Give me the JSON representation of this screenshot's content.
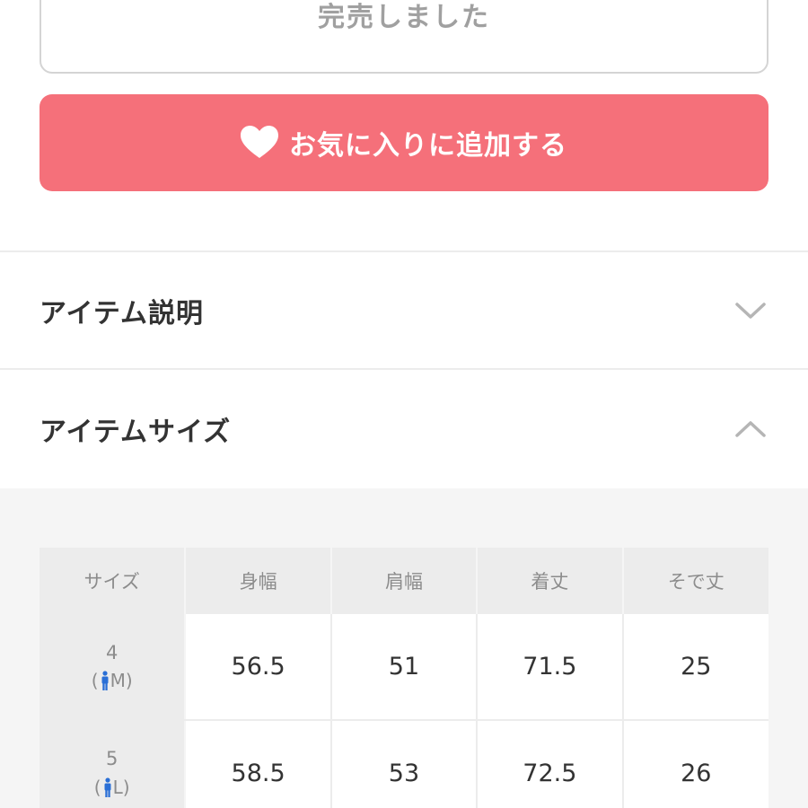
{
  "soldout": {
    "label": "完売しました"
  },
  "favorite": {
    "label": "お気に入りに追加する",
    "color": "#f5707a"
  },
  "accordion": [
    {
      "title": "アイテム説明",
      "expanded": false
    },
    {
      "title": "アイテムサイズ",
      "expanded": true
    }
  ],
  "size_table": {
    "headers": [
      "サイズ",
      "身幅",
      "肩幅",
      "着丈",
      "そで丈"
    ],
    "rows": [
      {
        "size": "4",
        "fit": "M",
        "values": [
          "56.5",
          "51",
          "71.5",
          "25"
        ]
      },
      {
        "size": "5",
        "fit": "L",
        "values": [
          "58.5",
          "53",
          "72.5",
          "26"
        ]
      }
    ]
  },
  "icons": [
    "heart-icon",
    "chevron-down-icon",
    "chevron-up-icon",
    "person-icon"
  ]
}
